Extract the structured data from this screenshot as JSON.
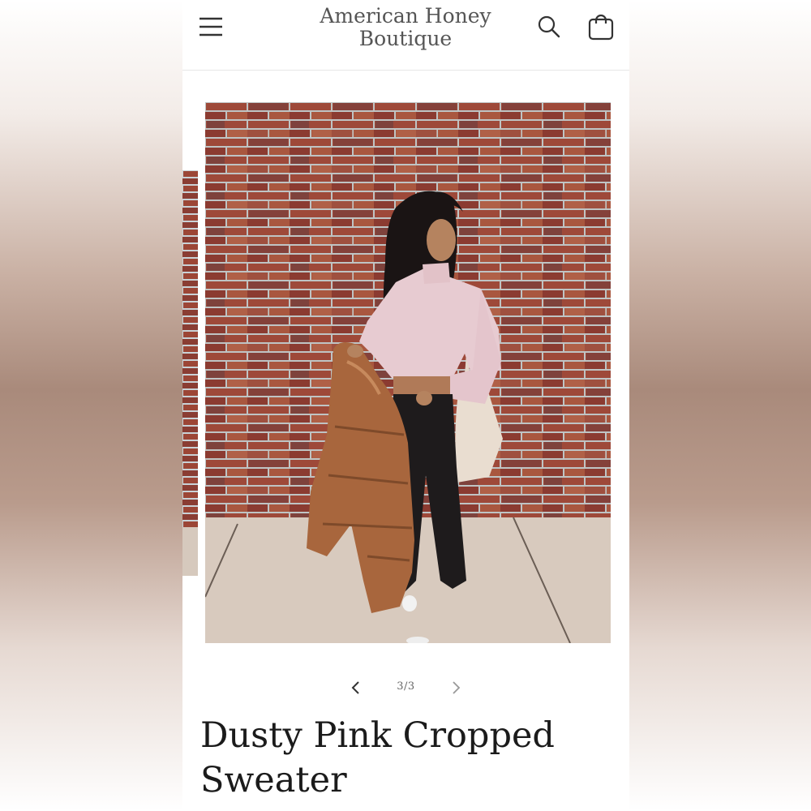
{
  "header": {
    "brand_line1": "American Honey",
    "brand_line2": "Boutique",
    "icons": {
      "menu": "hamburger-menu-icon",
      "search": "search-icon",
      "cart": "shopping-bag-icon"
    }
  },
  "gallery": {
    "current": "3/3",
    "prev_icon": "chevron-left-icon",
    "next_icon": "chevron-right-icon"
  },
  "product": {
    "title": "Dusty Pink Cropped Sweater"
  },
  "colors": {
    "brick": "#9b4a3c",
    "sidewalk": "#d9ccc0",
    "sweater": "#e8cfd3",
    "jacket": "#a5673f",
    "pants": "#1f1c1d"
  }
}
